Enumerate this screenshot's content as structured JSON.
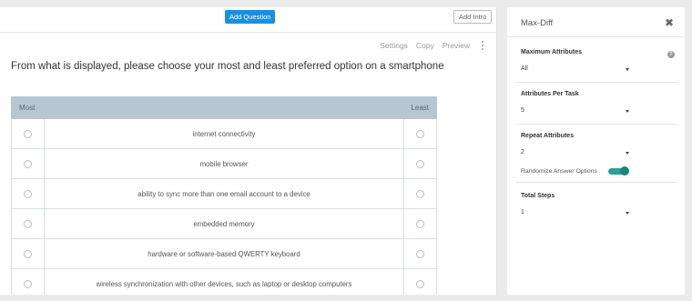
{
  "topbar": {
    "add_question": "Add Question",
    "add_intro": "Add Intro"
  },
  "toolbar": {
    "settings": "Settings",
    "copy": "Copy",
    "preview": "Preview"
  },
  "question": {
    "text": "From what is displayed, please choose your most and least preferred option on a smartphone"
  },
  "grid": {
    "most_label": "Most",
    "least_label": "Least",
    "options": [
      "internet connectivity",
      "mobile browser",
      "ability to sync more than one email account to a device",
      "embedded memory",
      "hardware or software-based QWERTY keyboard",
      "wireless synchronization with other devices, such as laptop or desktop computers"
    ]
  },
  "panel": {
    "title": "Max-Diff",
    "close": "✖",
    "help": "?",
    "max_attributes": {
      "label": "Maximum Attributes",
      "value": "All"
    },
    "attributes_per_task": {
      "label": "Attributes Per Task",
      "value": "5"
    },
    "repeat_attributes": {
      "label": "Repeat Attributes",
      "value": "2"
    },
    "randomize": {
      "label": "Randomize Answer Options",
      "on": true
    },
    "total_steps": {
      "label": "Total Steps",
      "value": "1"
    }
  },
  "colors": {
    "accent_button": "#1a8fe0",
    "grid_header": "#b7c7d2",
    "toggle": "#2f9e96"
  }
}
